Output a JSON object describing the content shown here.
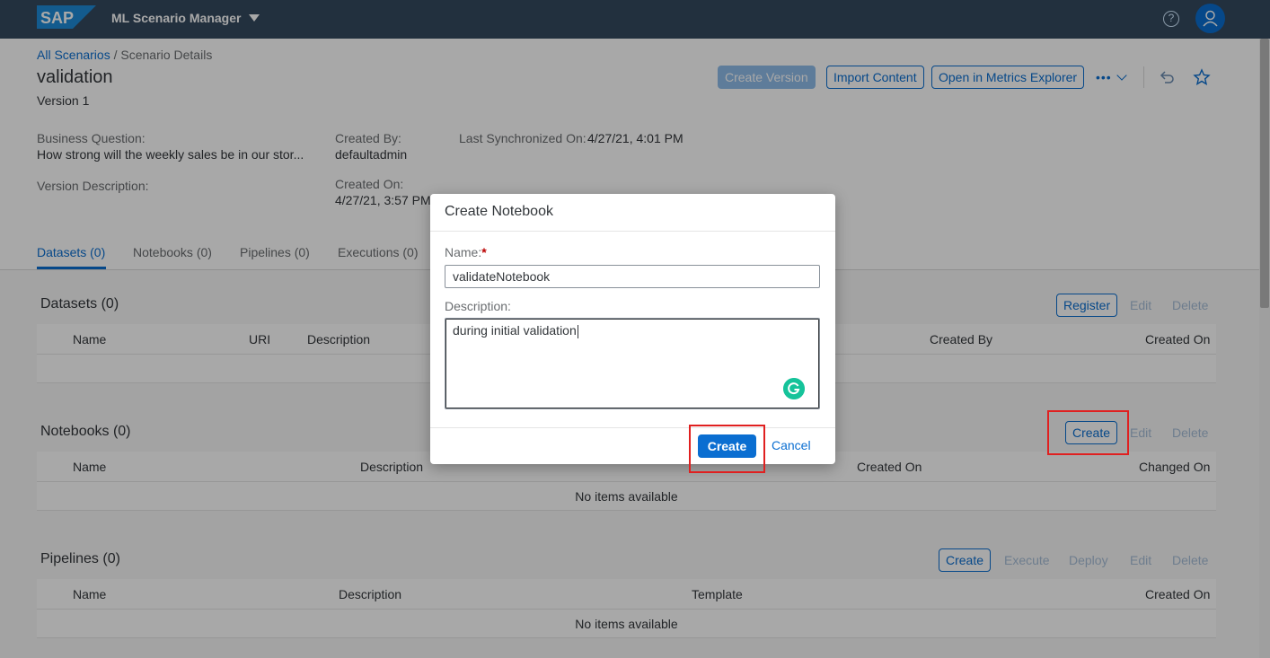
{
  "shell": {
    "logo_text": "SAP",
    "app_title": "ML Scenario Manager",
    "help_icon": "question-mark-icon",
    "avatar_icon": "person-icon"
  },
  "breadcrumb": {
    "link": "All Scenarios",
    "separator": " / ",
    "current": "Scenario Details"
  },
  "page": {
    "title": "validation",
    "version": "Version 1"
  },
  "header_actions": {
    "create_version": "Create Version",
    "import_content": "Import Content",
    "open_metrics": "Open in Metrics Explorer",
    "more": "•••"
  },
  "attributes": {
    "business_question_label": "Business Question:",
    "business_question_value": "How strong will the weekly sales be in our stor...",
    "created_by_label": "Created By:",
    "created_by_value": "defaultadmin",
    "last_sync_label": "Last Synchronized On:",
    "last_sync_value": "4/27/21, 4:01 PM",
    "version_desc_label": "Version Description:",
    "created_on_label": "Created On:",
    "created_on_value": "4/27/21, 3:57 PM"
  },
  "tabs": [
    {
      "label": "Datasets (0)",
      "active": true
    },
    {
      "label": "Notebooks (0)",
      "active": false
    },
    {
      "label": "Pipelines (0)",
      "active": false
    },
    {
      "label": "Executions (0)",
      "active": false
    }
  ],
  "datasets": {
    "title": "Datasets (0)",
    "register": "Register",
    "edit": "Edit",
    "delete": "Delete",
    "columns": [
      "Name",
      "URI",
      "Description",
      "Created By",
      "Created On"
    ]
  },
  "notebooks": {
    "title": "Notebooks (0)",
    "create": "Create",
    "edit": "Edit",
    "delete": "Delete",
    "columns": [
      "Name",
      "Description",
      "Created On",
      "Changed On"
    ],
    "empty": "No items available"
  },
  "pipelines": {
    "title": "Pipelines (0)",
    "create": "Create",
    "execute": "Execute",
    "deploy": "Deploy",
    "edit": "Edit",
    "delete": "Delete",
    "columns": [
      "Name",
      "Description",
      "Template",
      "Created On"
    ],
    "empty": "No items available"
  },
  "dialog": {
    "title": "Create Notebook",
    "name_label": "Name:",
    "required_mark": "*",
    "name_value": "validateNotebook",
    "description_label": "Description:",
    "description_value": "during initial validation",
    "create": "Create",
    "cancel": "Cancel"
  },
  "colors": {
    "shell_bg": "#354a5f",
    "accent": "#0a6ed1",
    "highlight": "#e02020"
  }
}
